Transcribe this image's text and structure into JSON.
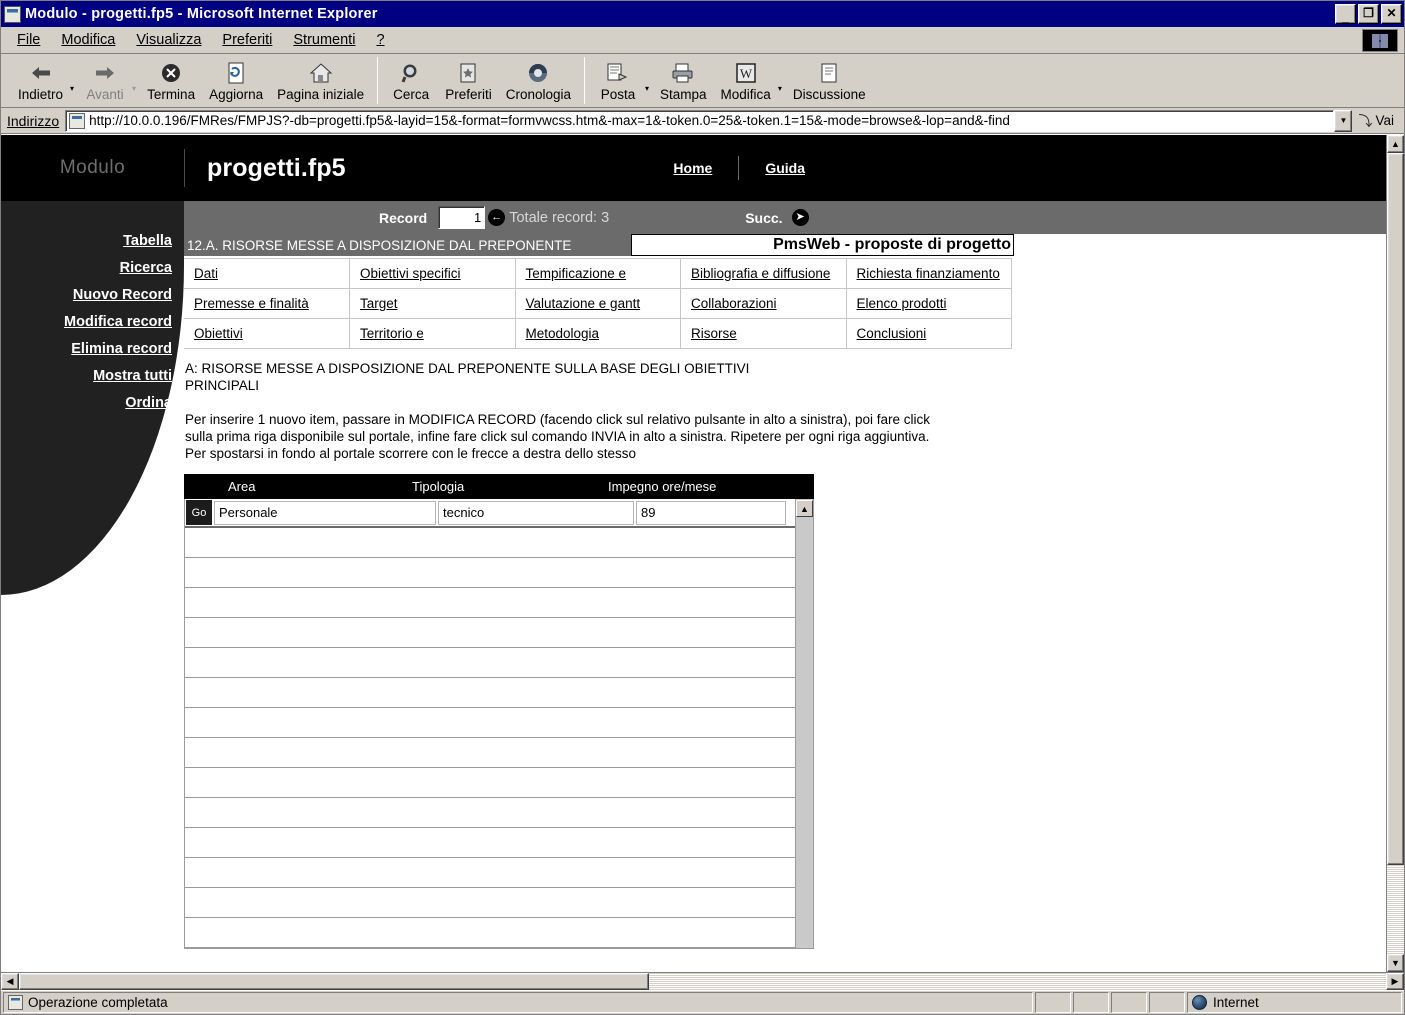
{
  "window": {
    "title": "Modulo - progetti.fp5 - Microsoft Internet Explorer",
    "minimize_label": "_",
    "maximize_label": "❐",
    "close_label": "✕"
  },
  "menubar": {
    "items": [
      {
        "label": "File",
        "icon": "menu-file"
      },
      {
        "label": "Modifica",
        "icon": "menu-edit"
      },
      {
        "label": "Visualizza",
        "icon": "menu-view"
      },
      {
        "label": "Preferiti",
        "icon": "menu-favorites"
      },
      {
        "label": "Strumenti",
        "icon": "menu-tools"
      },
      {
        "label": "?",
        "icon": "menu-help"
      }
    ]
  },
  "toolbar": {
    "buttons": [
      {
        "label": "Indietro",
        "icon": "back-arrow-icon",
        "disabled": false,
        "dropdown": true
      },
      {
        "label": "Avanti",
        "icon": "forward-arrow-icon",
        "disabled": true,
        "dropdown": true
      },
      {
        "label": "Termina",
        "icon": "stop-icon",
        "disabled": false,
        "dropdown": false
      },
      {
        "label": "Aggiorna",
        "icon": "refresh-icon",
        "disabled": false,
        "dropdown": false
      },
      {
        "label": "Pagina iniziale",
        "icon": "home-icon",
        "disabled": false,
        "dropdown": false
      },
      {
        "label": "Cerca",
        "icon": "search-icon",
        "disabled": false,
        "dropdown": false
      },
      {
        "label": "Preferiti",
        "icon": "favorites-star-icon",
        "disabled": false,
        "dropdown": false
      },
      {
        "label": "Cronologia",
        "icon": "history-clock-icon",
        "disabled": false,
        "dropdown": false
      },
      {
        "label": "Posta",
        "icon": "mail-icon",
        "disabled": false,
        "dropdown": true
      },
      {
        "label": "Stampa",
        "icon": "printer-icon",
        "disabled": false,
        "dropdown": false
      },
      {
        "label": "Modifica",
        "icon": "word-edit-icon",
        "disabled": false,
        "dropdown": true
      },
      {
        "label": "Discussione",
        "icon": "discussion-icon",
        "disabled": false,
        "dropdown": false
      }
    ]
  },
  "address": {
    "label": "Indirizzo",
    "url": "http://10.0.0.196/FMRes/FMPJS?-db=progetti.fp5&-layid=15&-format=formvwcss.htm&-max=1&-token.0=25&-token.1=15&-mode=browse&-lop=and&-find",
    "go_label": "Vai"
  },
  "site": {
    "brand": "Modulo",
    "database": "progetti.fp5",
    "links": [
      {
        "label": "Home"
      },
      {
        "label": "Guida"
      }
    ]
  },
  "recordbar": {
    "record_label": "Record",
    "record_value": "1",
    "prev_icon": "previous-record-icon",
    "total_label": "Totale record: 3",
    "next_label": "Succ.",
    "next_icon": "next-record-icon"
  },
  "leftnav": {
    "items": [
      {
        "label": "Tabella"
      },
      {
        "label": "Ricerca"
      },
      {
        "label": "Nuovo Record"
      },
      {
        "label": "Modifica record"
      },
      {
        "label": "Elimina record"
      },
      {
        "label": "Mostra tutti"
      },
      {
        "label": "Ordina"
      }
    ]
  },
  "section": {
    "title": "12.A. RISORSE MESSE A DISPOSIZIONE DAL PREPONENTE",
    "app_title": "PmsWeb - proposte di progetto"
  },
  "navgrid": {
    "rows": [
      [
        {
          "label": "Dati"
        },
        {
          "label": "Obiettivi specifici"
        },
        {
          "label": "Tempificazione e"
        },
        {
          "label": "Bibliografia e diffusione"
        },
        {
          "label": "Richiesta finanziamento"
        }
      ],
      [
        {
          "label": "Premesse e finalità"
        },
        {
          "label": "Target"
        },
        {
          "label": "Valutazione e gantt"
        },
        {
          "label": "Collaborazioni"
        },
        {
          "label": "Elenco prodotti"
        }
      ],
      [
        {
          "label": "Obiettivi"
        },
        {
          "label": "Territorio e"
        },
        {
          "label": "Metodologia"
        },
        {
          "label": "Risorse"
        },
        {
          "label": "Conclusioni"
        }
      ]
    ]
  },
  "body": {
    "heading": "A: RISORSE MESSE A DISPOSIZIONE DAL PREPONENTE SULLA BASE DEGLI OBIETTIVI PRINCIPALI",
    "paragraph": "Per inserire 1 nuovo item, passare in MODIFICA RECORD (facendo click sul relativo pulsante in alto a sinistra), poi fare click sulla prima riga disponibile sul portale, infine fare click sul comando INVIA in alto a sinistra. Ripetere per ogni riga aggiuntiva. Per spostarsi in fondo al portale scorrere con le frecce a destra dello stesso"
  },
  "portal": {
    "columns": [
      "Area",
      "Tipologia",
      "Impegno ore/mese"
    ],
    "go_label": "Go",
    "rows": [
      {
        "area": "Personale",
        "tipologia": "tecnico",
        "impegno": "89"
      }
    ],
    "empty_row_count": 14,
    "scroll_up_icon": "scroll-up-icon"
  },
  "statusbar": {
    "message": "Operazione completata",
    "zone": "Internet",
    "zone_icon": "internet-zone-icon",
    "doc_icon": "document-icon"
  }
}
